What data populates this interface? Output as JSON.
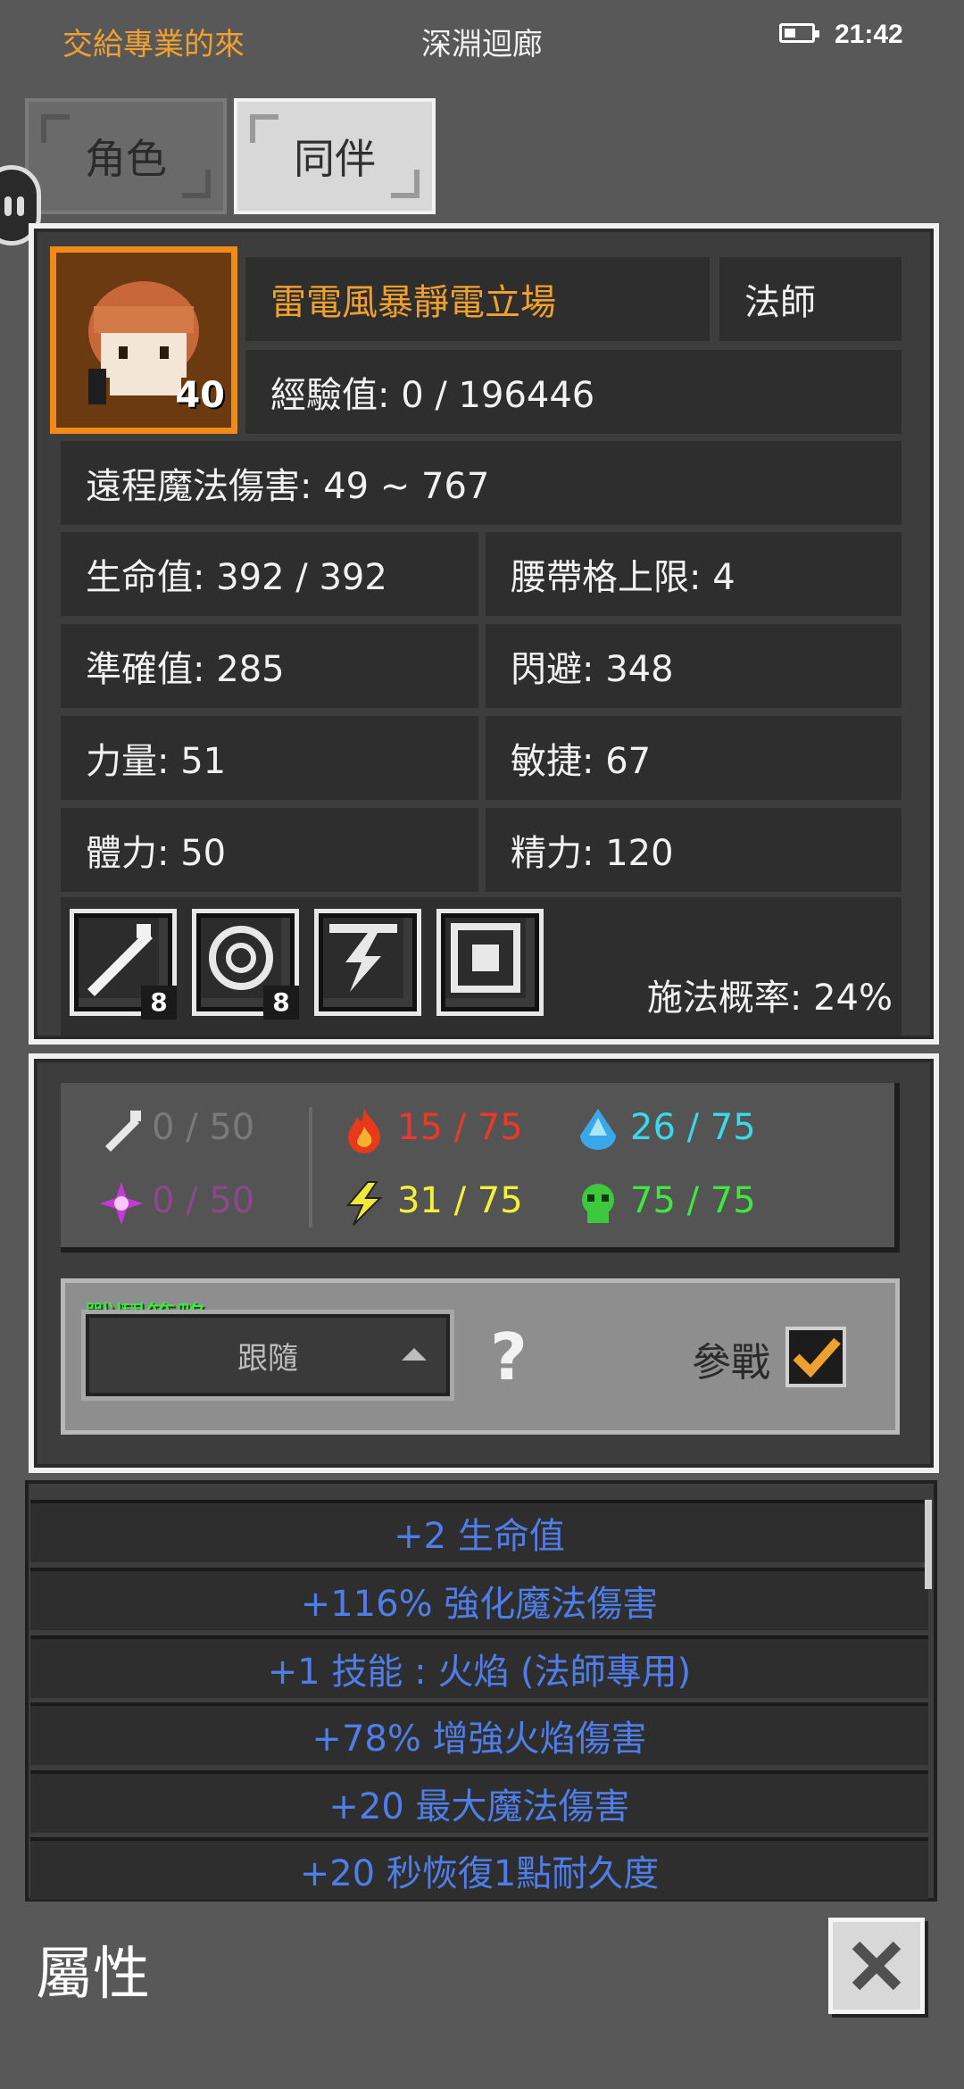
{
  "status_bar": {
    "left_text": "交給專業的來",
    "title": "深淵迴廊",
    "time": "21:42"
  },
  "tabs": [
    {
      "label": "角色"
    },
    {
      "label": "同伴"
    }
  ],
  "companion": {
    "level": "40",
    "name": "雷電風暴靜電立場",
    "class": "法師",
    "exp": "經驗值: 0 / 196446",
    "damage": "遠程魔法傷害: 49 ~ 767",
    "stats": [
      {
        "left": "生命值: 392 / 392",
        "right": "腰帶格上限: 4"
      },
      {
        "left": "準確值: 285",
        "right": "閃避: 348"
      },
      {
        "left": "力量: 51",
        "right": "敏捷: 67"
      },
      {
        "left": "體力: 50",
        "right": "精力: 120"
      }
    ],
    "skills": [
      {
        "icon": "wand-skill-icon",
        "level": "8"
      },
      {
        "icon": "rune-circle-skill-icon",
        "level": "8"
      },
      {
        "icon": "lightning-skill-icon",
        "level": ""
      },
      {
        "icon": "static-field-skill-icon",
        "level": ""
      }
    ],
    "cast_rate": "施法概率: 24%"
  },
  "resistances": {
    "physical": "0 / 50",
    "poison_magic": "0 / 50",
    "fire": "15 / 75",
    "lightning": "31 / 75",
    "cold": "26 / 75",
    "toxic": "75 / 75",
    "colors": {
      "physical": "#7a7a7a",
      "poison_magic": "#8a4a8a",
      "fire": "#e83a2a",
      "lightning": "#f2f23a",
      "cold": "#3ad8e8",
      "toxic": "#3ee83e"
    }
  },
  "strategy": {
    "label": "戰鬥策略",
    "selected": "跟隨",
    "join_label": "參戰",
    "joined": true
  },
  "attributes": [
    "+2 生命值",
    "+116% 強化魔法傷害",
    "+1 技能 : 火焰 (法師專用)",
    "+78% 增強火焰傷害",
    "+20 最大魔法傷害",
    "+20 秒恢復1點耐久度"
  ],
  "footer": {
    "title": "屬性"
  }
}
